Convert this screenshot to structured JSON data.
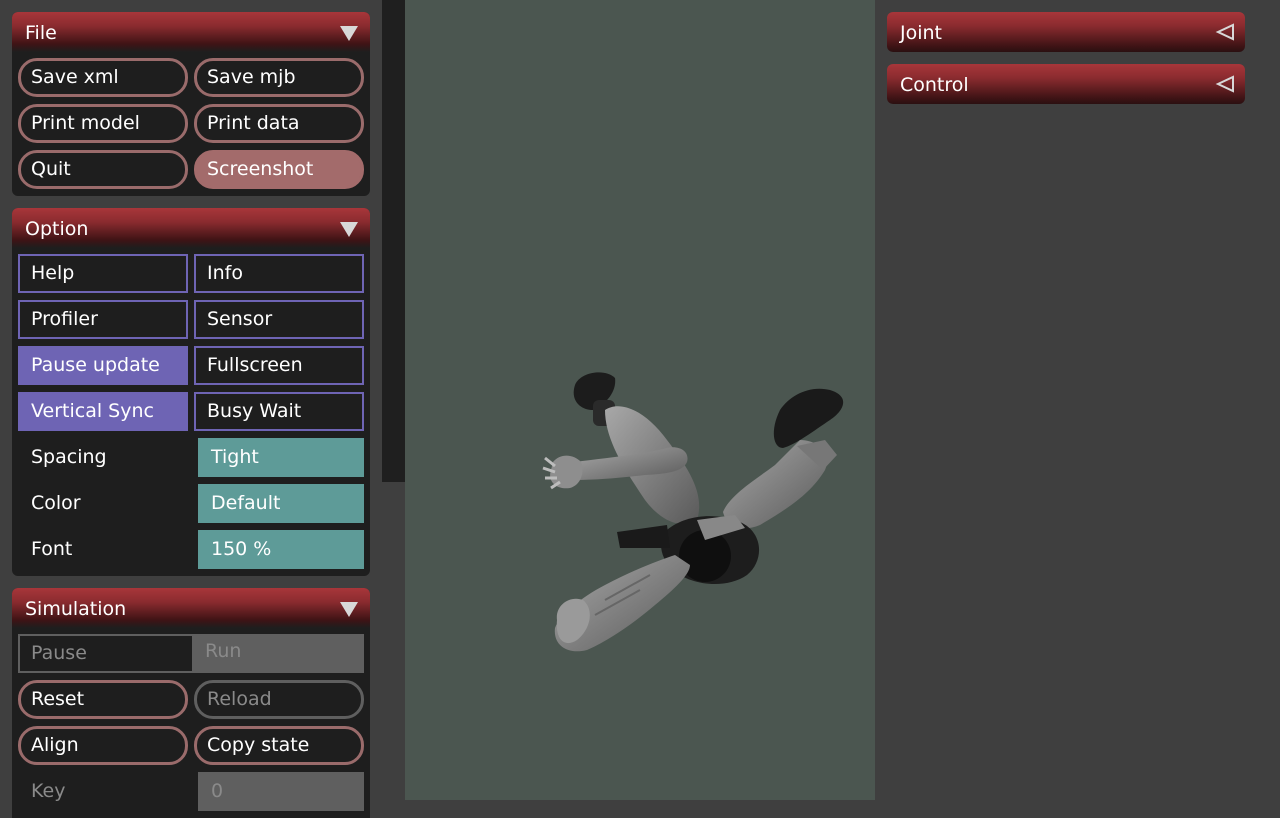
{
  "file_section": {
    "title": "File",
    "buttons": {
      "save_xml": "Save xml",
      "save_mjb": "Save mjb",
      "print_model": "Print model",
      "print_data": "Print data",
      "quit": "Quit",
      "screenshot": "Screenshot"
    }
  },
  "option_section": {
    "title": "Option",
    "toggles": {
      "help": "Help",
      "info": "Info",
      "profiler": "Profiler",
      "sensor": "Sensor",
      "pause_update": "Pause update",
      "fullscreen": "Fullscreen",
      "vertical_sync": "Vertical Sync",
      "busy_wait": "Busy Wait"
    },
    "spacing": {
      "label": "Spacing",
      "value": "Tight"
    },
    "color": {
      "label": "Color",
      "value": "Default"
    },
    "font": {
      "label": "Font",
      "value": "150 %"
    }
  },
  "simulation_section": {
    "title": "Simulation",
    "run_mode": {
      "pause": "Pause",
      "run": "Run",
      "selected": "Pause"
    },
    "buttons": {
      "reset": "Reset",
      "reload": "Reload",
      "align": "Align",
      "copy_state": "Copy state"
    },
    "key": {
      "label": "Key",
      "value": "0"
    }
  },
  "right_panel": {
    "joint_title": "Joint",
    "control_title": "Control"
  },
  "colors": {
    "header_red": "#a8363a",
    "button_border": "#9a6b6b",
    "checkbox_purple": "#6e64b4",
    "select_teal": "#5e9b98",
    "viewport_bg": "#4b5650"
  }
}
